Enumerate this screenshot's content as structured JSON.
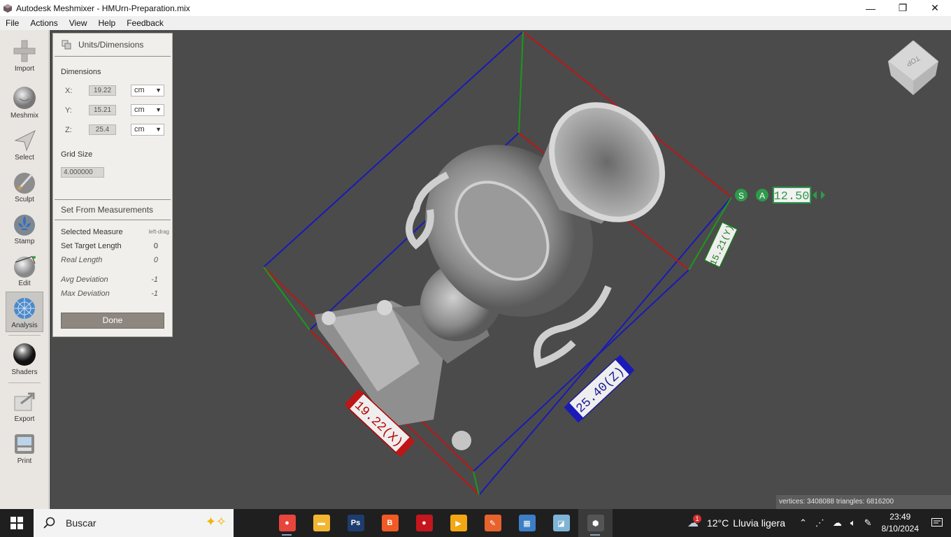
{
  "window": {
    "title": "Autodesk Meshmixer - HMUrn-Preparation.mix",
    "minimize": "—",
    "maximize": "❐",
    "close": "✕"
  },
  "menu": [
    "File",
    "Actions",
    "View",
    "Help",
    "Feedback"
  ],
  "toolbar": [
    {
      "label": "Import",
      "icon": "plus-icon"
    },
    {
      "label": "Meshmix",
      "icon": "meshmix-sphere-icon"
    },
    {
      "label": "Select",
      "icon": "arrow-cursor-icon"
    },
    {
      "label": "Sculpt",
      "icon": "brush-icon"
    },
    {
      "label": "Stamp",
      "icon": "fleur-de-lis-icon"
    },
    {
      "label": "Edit",
      "icon": "edit-sphere-icon"
    },
    {
      "label": "Analysis",
      "icon": "analysis-mesh-icon",
      "active": true
    },
    {
      "label": "Shaders",
      "icon": "shader-ball-icon"
    },
    {
      "label": "Export",
      "icon": "export-icon"
    },
    {
      "label": "Print",
      "icon": "printer-icon"
    }
  ],
  "panel": {
    "title": "Units/Dimensions",
    "dimensions_label": "Dimensions",
    "dims": [
      {
        "axis": "X:",
        "value": "19.22",
        "unit": "cm"
      },
      {
        "axis": "Y:",
        "value": "15.21",
        "unit": "cm"
      },
      {
        "axis": "Z:",
        "value": "25.4",
        "unit": "cm"
      }
    ],
    "grid_label": "Grid Size",
    "grid_value": "4.000000",
    "measurements_title": "Set From Measurements",
    "selected_measure": "Selected Measure",
    "selected_measure_hint": "left-drag",
    "target_length": "Set Target Length",
    "target_length_value": "0",
    "real_length": "Real Length",
    "real_length_value": "0",
    "avg_deviation": "Avg Deviation",
    "avg_deviation_value": "-1",
    "max_deviation": "Max Deviation",
    "max_deviation_value": "-1",
    "done": "Done"
  },
  "viewport": {
    "dim_labels": {
      "x": "19.22(X)",
      "z": "25.40(Z)",
      "y": "15.21(Y)"
    },
    "scale_value": "12.50",
    "scale_s": "S",
    "scale_a": "A",
    "viewcube_label": "TOP",
    "stats": "vertices: 3408088 triangles: 6816200"
  },
  "taskbar": {
    "search_placeholder": "Buscar",
    "apps": [
      {
        "name": "chrome",
        "color": "#e8453c",
        "glyph": "●"
      },
      {
        "name": "file-explorer",
        "color": "#f2b632",
        "glyph": "▬"
      },
      {
        "name": "photoshop",
        "color": "#1c3d6e",
        "glyph": "Ps"
      },
      {
        "name": "brave",
        "color": "#f15a24",
        "glyph": "B"
      },
      {
        "name": "red-app",
        "color": "#c4161c",
        "glyph": "●"
      },
      {
        "name": "media-app",
        "color": "#f3a712",
        "glyph": "▶"
      },
      {
        "name": "pen-app",
        "color": "#e8622c",
        "glyph": "✎"
      },
      {
        "name": "photos-app",
        "color": "#3c7fc6",
        "glyph": "▦"
      },
      {
        "name": "book-app",
        "color": "#7fb4d6",
        "glyph": "◪"
      },
      {
        "name": "meshmixer",
        "color": "#555555",
        "glyph": "⬢"
      }
    ],
    "weather_temp": "12°C",
    "weather_text": "Lluvia ligera",
    "weather_badge": "1",
    "time": "23:49",
    "date": "8/10/2024"
  }
}
